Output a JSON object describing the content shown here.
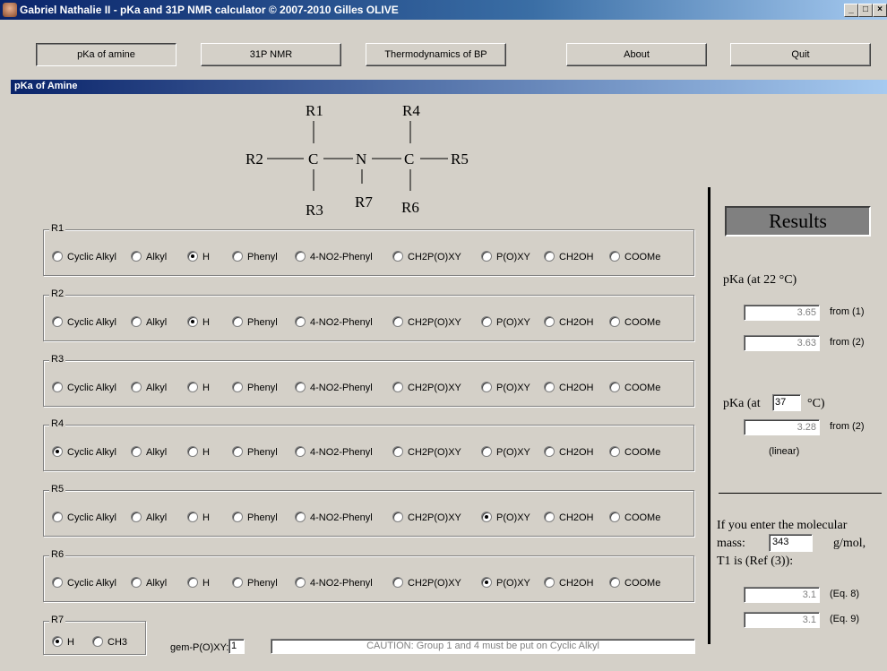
{
  "window": {
    "title": "Gabriel Nathalie II - pKa and 31P NMR calculator © 2007-2010 Gilles OLIVE",
    "controls": [
      "_",
      "□",
      "×"
    ]
  },
  "toolbar": {
    "buttons": [
      "pKa of amine",
      "31P NMR",
      "Thermodynamics of BP",
      "About",
      "Quit"
    ]
  },
  "panel": {
    "title": "pKa of Amine"
  },
  "structure": {
    "labels": [
      "R1",
      "R2",
      "C",
      "N",
      "C",
      "R5",
      "R3",
      "R7",
      "R6",
      "R4"
    ]
  },
  "groups": [
    {
      "label": "R1",
      "options": [
        "Cyclic Alkyl",
        "Alkyl",
        "H",
        "Phenyl",
        "4-NO2-Phenyl",
        "CH2P(O)XY",
        "P(O)XY",
        "CH2OH",
        "COOMe"
      ],
      "selected": "H"
    },
    {
      "label": "R2",
      "options": [
        "Cyclic Alkyl",
        "Alkyl",
        "H",
        "Phenyl",
        "4-NO2-Phenyl",
        "CH2P(O)XY",
        "P(O)XY",
        "CH2OH",
        "COOMe"
      ],
      "selected": "H"
    },
    {
      "label": "R3",
      "options": [
        "Cyclic Alkyl",
        "Alkyl",
        "H",
        "Phenyl",
        "4-NO2-Phenyl",
        "CH2P(O)XY",
        "P(O)XY",
        "CH2OH",
        "COOMe"
      ],
      "selected": ""
    },
    {
      "label": "R4",
      "options": [
        "Cyclic Alkyl",
        "Alkyl",
        "H",
        "Phenyl",
        "4-NO2-Phenyl",
        "CH2P(O)XY",
        "P(O)XY",
        "CH2OH",
        "COOMe"
      ],
      "selected": "Cyclic Alkyl"
    },
    {
      "label": "R5",
      "options": [
        "Cyclic Alkyl",
        "Alkyl",
        "H",
        "Phenyl",
        "4-NO2-Phenyl",
        "CH2P(O)XY",
        "P(O)XY",
        "CH2OH",
        "COOMe"
      ],
      "selected": "P(O)XY"
    },
    {
      "label": "R6",
      "options": [
        "Cyclic Alkyl",
        "Alkyl",
        "H",
        "Phenyl",
        "4-NO2-Phenyl",
        "CH2P(O)XY",
        "P(O)XY",
        "CH2OH",
        "COOMe"
      ],
      "selected": "P(O)XY"
    }
  ],
  "r7": {
    "label": "R7",
    "options": [
      "H",
      "CH3"
    ],
    "selected": "H"
  },
  "gem": {
    "label": "gem-P(O)XY:",
    "value": "1"
  },
  "caution": "CAUTION: Group 1 and 4 must be put on Cyclic Alkyl",
  "results": {
    "title": "Results",
    "pka22_label": "pKa (at 22 °C)",
    "pka22_v1": "3.65",
    "from1": "from (1)",
    "pka22_v2": "3.63",
    "from2": "from (2)",
    "pka_at_label": "pKa (at",
    "temp": "37",
    "deg_label": "°C)",
    "pka_t_value": "3.28",
    "from2b": "from (2)",
    "linear": "(linear)",
    "mm_text1": "If you enter the molecular",
    "mm_text2": "mass:",
    "mass": "343",
    "unit": "g/mol,",
    "t1_text": "T1 is (Ref (3)):",
    "eq8_value": "3.1",
    "eq8": "(Eq. 8)",
    "eq9_value": "3.1",
    "eq9": "(Eq. 9)"
  }
}
